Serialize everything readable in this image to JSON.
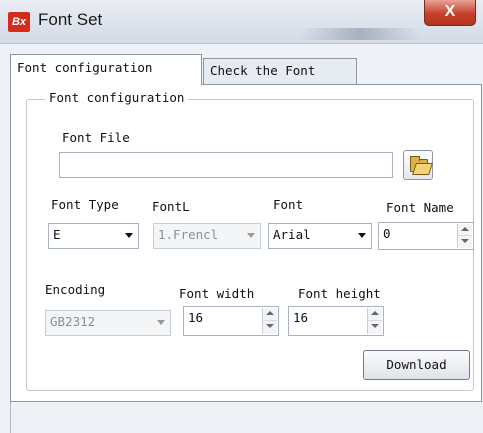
{
  "window": {
    "title": "Font Set",
    "app_icon_text": "Bx",
    "close_glyph": "X"
  },
  "tabs": [
    {
      "label": "Font configuration",
      "active": true
    },
    {
      "label": "Check the Font",
      "active": false
    }
  ],
  "group": {
    "legend": "Font configuration"
  },
  "font_file": {
    "label": "Font File",
    "value": "",
    "browse_icon": "open-folder-icon"
  },
  "font_type": {
    "label": "Font Type",
    "value": "E"
  },
  "font_l": {
    "label": "FontL",
    "value": "1.Frencl"
  },
  "font": {
    "label": "Font",
    "value": "Arial"
  },
  "font_name": {
    "label": "Font Name",
    "value": "0"
  },
  "encoding": {
    "label": "Encoding",
    "value": "GB2312"
  },
  "font_width": {
    "label": "Font width",
    "value": "16"
  },
  "font_height": {
    "label": "Font height",
    "value": "16"
  },
  "download_button": {
    "label": "Download"
  },
  "colors": {
    "close_button": "#c6412c",
    "app_icon": "#d42c1c",
    "panel_bg": "#ffffff",
    "window_bg": "#eef1f6"
  }
}
